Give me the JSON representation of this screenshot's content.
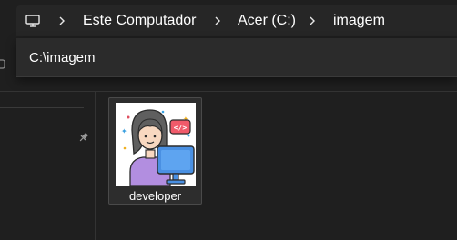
{
  "breadcrumb": {
    "root_icon": "pc-icon",
    "items": [
      "Este Computador",
      "Acer (C:)",
      "imagem"
    ]
  },
  "address_bar": {
    "value": "C:\\imagem"
  },
  "files": [
    {
      "name": "developer",
      "thumbnail": "developer-illustration"
    }
  ],
  "nav_pane": {
    "pin_icon": "pin-icon"
  }
}
